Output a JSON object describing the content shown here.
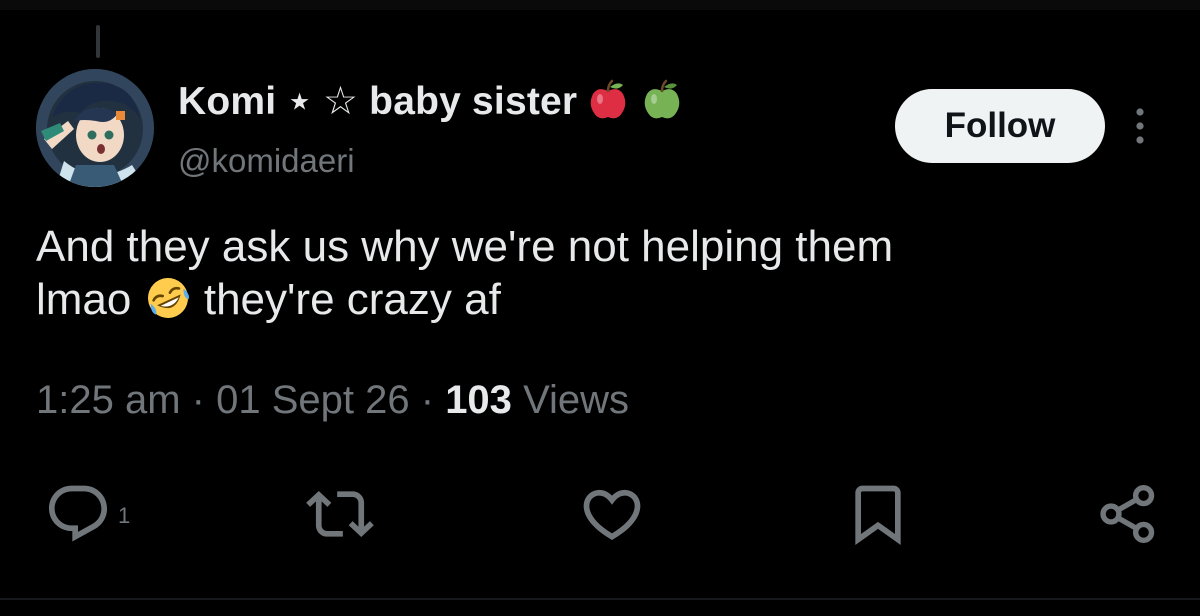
{
  "author": {
    "display_name": "Komi ⋆ ☆ baby sister",
    "handle": "@komidaeri",
    "name_emojis": [
      "red-apple-icon",
      "green-apple-icon"
    ]
  },
  "follow_button": {
    "label": "Follow"
  },
  "post": {
    "text_line1": "And they ask us why we're not helping them",
    "text_line2_a": "lmao",
    "text_line2_emoji": "rolling-on-floor-laughing-icon",
    "text_line2_b": "they're crazy af"
  },
  "meta": {
    "time": "1:25 am",
    "separator": "·",
    "date": "01 Sept 26",
    "views_count": "103",
    "views_label": "Views"
  },
  "actions": {
    "reply_count": "1",
    "icons": [
      "reply-icon",
      "repost-icon",
      "like-icon",
      "bookmark-icon",
      "share-icon"
    ]
  },
  "colors": {
    "background": "#000000",
    "primary_text": "#e7e9ea",
    "secondary_text": "#71767b",
    "follow_button_bg": "#eff3f4",
    "follow_button_text": "#0f1419"
  }
}
